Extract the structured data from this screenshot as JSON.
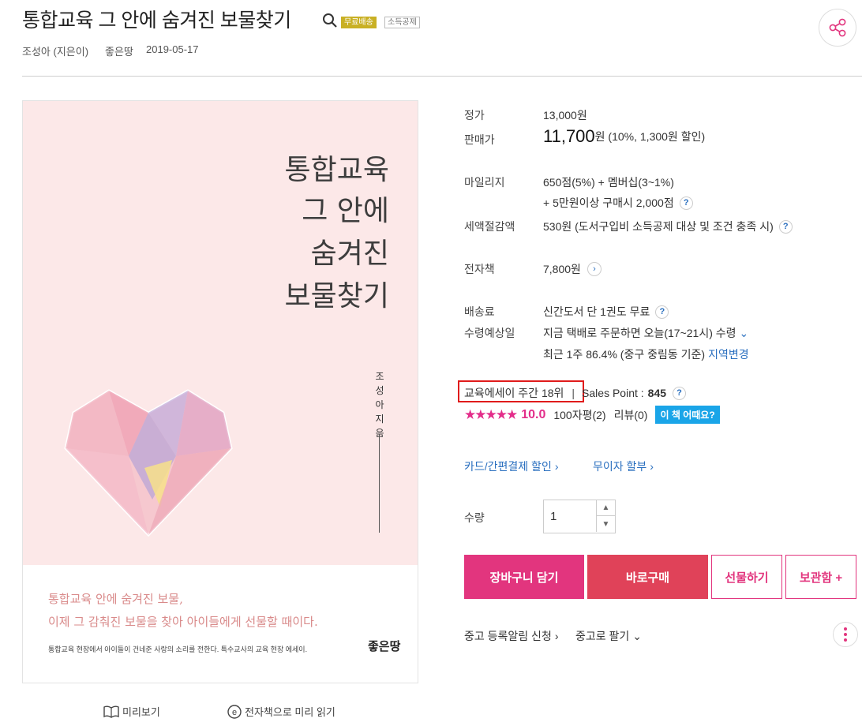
{
  "header": {
    "title": "통합교육 그 안에 숨겨진 보물찾기",
    "badge_free": "무료배송",
    "badge_tax": "소득공제",
    "author": "조성아 (지은이)",
    "publisher": "좋은땅",
    "date": "2019-05-17"
  },
  "cover": {
    "title_lines": [
      "통합교육",
      "그 안에",
      "숨겨진",
      "보물찾기"
    ],
    "author_vertical": "조성아 지음",
    "tagline1": "통합교육 안에 숨겨진 보물,",
    "tagline2": "이제 그 감춰진 보물을 찾아 아이들에게 선물할 때이다.",
    "desc": "통합교육 현장에서 아이들이 건네준 사랑의 소리를 전한다. 특수교사의 교육 현장 에세이.",
    "publisher_logo": "좋은땅"
  },
  "preview": {
    "preview_label": "미리보기",
    "ebook_preview_label": "전자책으로 미리 읽기"
  },
  "info": {
    "list_price_label": "정가",
    "list_price": "13,000원",
    "sale_price_label": "판매가",
    "sale_price": "11,700",
    "sale_price_suffix": "원 (10%, 1,300원 할인)",
    "mileage_label": "마일리지",
    "mileage1": "650점(5%) + 멤버십(3~1%)",
    "mileage2": "+ 5만원이상 구매시 2,000점",
    "tax_label": "세액절감액",
    "tax_value": "530원 (도서구입비 소득공제 대상 및 조건 충족 시)",
    "ebook_label": "전자책",
    "ebook_price": "7,800원",
    "shipping_label": "배송료",
    "shipping_value": "신간도서 단 1권도 무료",
    "delivery_label": "수령예상일",
    "delivery_value": "지금 택배로 주문하면 오늘(17~21시) 수령",
    "delivery_rate": "최근 1주 86.4% (중구 중림동 기준)",
    "region_change": "지역변경",
    "rank": "교육에세이 주간 18위",
    "sales_point_label": "Sales Point :",
    "sales_point": "845",
    "score": "10.0",
    "rating_count": "100자평(2)",
    "review_count": "리뷰(0)",
    "eval_button": "이 책 어때요?",
    "card_discount": "카드/간편결제 할인",
    "installment": "무이자 할부",
    "qty_label": "수량",
    "qty_value": "1"
  },
  "actions": {
    "cart": "장바구니 담기",
    "buy": "바로구매",
    "gift": "선물하기",
    "keep": "보관함 +",
    "used_alert": "중고 등록알림 신청",
    "sell_used": "중고로 팔기"
  },
  "colors": {
    "accent": "#e2357e",
    "buy": "#e04259",
    "link": "#2a6fbf",
    "badge": "#c9b024",
    "highlight": "#e01b1b",
    "cover_bg": "#fce8e8"
  },
  "rating_stars": 5
}
